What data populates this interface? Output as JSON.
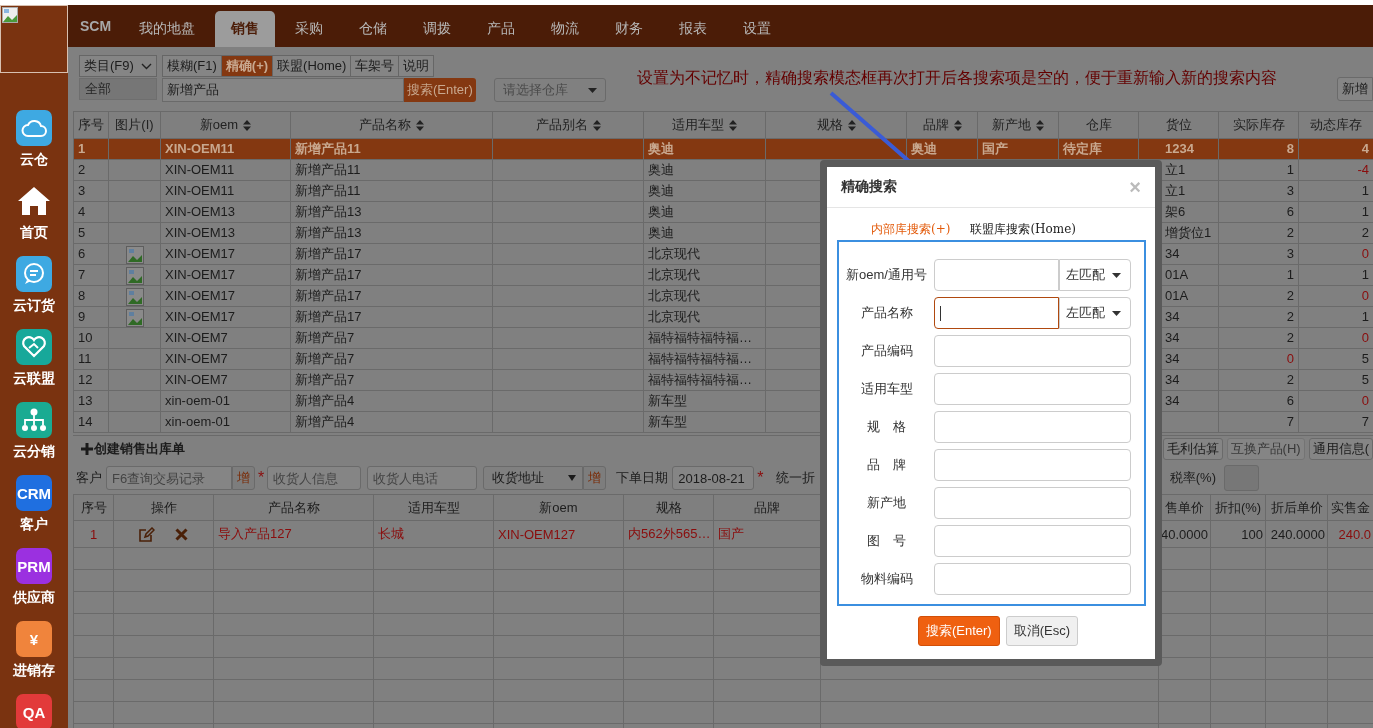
{
  "sidebar": {
    "items": [
      {
        "label": "云仓",
        "kind": "cloud",
        "color": "#3ea9e2"
      },
      {
        "label": "首页",
        "kind": "house"
      },
      {
        "label": "云订货",
        "kind": "chat",
        "color": "#3ea9e2"
      },
      {
        "label": "云联盟",
        "kind": "heart",
        "color": "#17a89a"
      },
      {
        "label": "云分销",
        "kind": "network",
        "color": "#1aab92"
      },
      {
        "label": "客户",
        "kind": "text",
        "badge": "CRM",
        "color": "#1f6fe0"
      },
      {
        "label": "供应商",
        "kind": "text",
        "badge": "PRM",
        "color": "#9b30e0"
      },
      {
        "label": "进销存",
        "kind": "text",
        "badge": "¥",
        "color": "#f0843c"
      },
      {
        "kind": "text",
        "badge": "QA",
        "color": "#e23a3a"
      }
    ]
  },
  "nav": {
    "brand": "SCM",
    "tabs": [
      {
        "label": "我的地盘",
        "selected": false
      },
      {
        "label": "销售",
        "selected": true
      },
      {
        "label": "采购",
        "selected": false
      },
      {
        "label": "仓储",
        "selected": false
      },
      {
        "label": "调拨",
        "selected": false
      },
      {
        "label": "产品",
        "selected": false
      },
      {
        "label": "物流",
        "selected": false
      },
      {
        "label": "财务",
        "selected": false
      },
      {
        "label": "报表",
        "selected": false
      },
      {
        "label": "设置",
        "selected": false
      }
    ]
  },
  "toolbar": {
    "category_select": "类目(F9)",
    "category_value": "全部",
    "modes": [
      {
        "label": "模糊(F1)",
        "selected": false
      },
      {
        "label": "精确(+)",
        "selected": true
      },
      {
        "label": "联盟(Home)",
        "selected": false
      },
      {
        "label": "车架号",
        "selected": false
      },
      {
        "label": "说明",
        "selected": false
      }
    ],
    "search": {
      "value": "新增产品"
    },
    "search_button": "搜索(Enter)",
    "warehouse_select": {
      "placeholder": "请选择仓库"
    },
    "new_button": "新增"
  },
  "annotation": "设置为不记忆时，精确搜索模态框再次打开后各搜索项是空的，便于重新输入新的搜索内容",
  "product_table": {
    "columns": [
      {
        "label": "序号",
        "sortable": false
      },
      {
        "label": "图片(I)",
        "sortable": false
      },
      {
        "label": "新oem",
        "sortable": true
      },
      {
        "label": "产品名称",
        "sortable": true
      },
      {
        "label": "产品别名",
        "sortable": true
      },
      {
        "label": "适用车型",
        "sortable": true
      },
      {
        "label": "规格",
        "sortable": true
      },
      {
        "label": "品牌",
        "sortable": true
      },
      {
        "label": "新产地",
        "sortable": true
      },
      {
        "label": "仓库",
        "sortable": false
      },
      {
        "label": "货位",
        "sortable": false
      },
      {
        "label": "实际库存",
        "sortable": false
      },
      {
        "label": "动态库存",
        "sortable": false
      }
    ],
    "rows": [
      {
        "no": "1",
        "image": false,
        "oem": "XIN-OEM11",
        "name": "新增产品11",
        "car": "奥迪",
        "brand": "奥迪",
        "origin": "国产",
        "warehouse": "待定库",
        "location": "1234",
        "actual": {
          "value": "8",
          "alert": false
        },
        "dynamic": {
          "value": "4",
          "alert": false
        },
        "selected": true
      },
      {
        "no": "2",
        "image": false,
        "oem": "XIN-OEM11",
        "name": "新增产品11",
        "car": "奥迪",
        "location": "立1",
        "actual": {
          "value": "1",
          "alert": false
        },
        "dynamic": {
          "value": "-4",
          "alert": true
        },
        "selected": false
      },
      {
        "no": "3",
        "image": false,
        "oem": "XIN-OEM11",
        "name": "新增产品11",
        "car": "奥迪",
        "location": "立1",
        "actual": {
          "value": "3",
          "alert": false
        },
        "dynamic": {
          "value": "1",
          "alert": false
        },
        "selected": false
      },
      {
        "no": "4",
        "image": false,
        "oem": "XIN-OEM13",
        "name": "新增产品13",
        "car": "奥迪",
        "location": "架6",
        "actual": {
          "value": "6",
          "alert": false
        },
        "dynamic": {
          "value": "1",
          "alert": false
        },
        "selected": false
      },
      {
        "no": "5",
        "image": false,
        "oem": "XIN-OEM13",
        "name": "新增产品13",
        "car": "奥迪",
        "location": "增货位1",
        "actual": {
          "value": "2",
          "alert": false
        },
        "dynamic": {
          "value": "2",
          "alert": false
        },
        "selected": false
      },
      {
        "no": "6",
        "image": true,
        "oem": "XIN-OEM17",
        "name": "新增产品17",
        "car": "北京现代",
        "location": "34",
        "actual": {
          "value": "3",
          "alert": false
        },
        "dynamic": {
          "value": "0",
          "alert": true
        },
        "selected": false
      },
      {
        "no": "7",
        "image": true,
        "oem": "XIN-OEM17",
        "name": "新增产品17",
        "car": "北京现代",
        "location": "01A",
        "actual": {
          "value": "1",
          "alert": false
        },
        "dynamic": {
          "value": "1",
          "alert": false
        },
        "selected": false
      },
      {
        "no": "8",
        "image": true,
        "oem": "XIN-OEM17",
        "name": "新增产品17",
        "car": "北京现代",
        "location": "01A",
        "actual": {
          "value": "2",
          "alert": false
        },
        "dynamic": {
          "value": "0",
          "alert": true
        },
        "selected": false
      },
      {
        "no": "9",
        "image": true,
        "oem": "XIN-OEM17",
        "name": "新增产品17",
        "car": "北京现代",
        "location": "34",
        "actual": {
          "value": "2",
          "alert": false
        },
        "dynamic": {
          "value": "1",
          "alert": false
        },
        "selected": false
      },
      {
        "no": "10",
        "image": false,
        "oem": "XIN-OEM7",
        "name": "新增产品7",
        "car": "福特福特福特福…",
        "location": "34",
        "actual": {
          "value": "2",
          "alert": false
        },
        "dynamic": {
          "value": "0",
          "alert": true
        },
        "selected": false
      },
      {
        "no": "11",
        "image": false,
        "oem": "XIN-OEM7",
        "name": "新增产品7",
        "car": "福特福特福特福…",
        "location": "34",
        "actual": {
          "value": "0",
          "alert": true
        },
        "dynamic": {
          "value": "5",
          "alert": false
        },
        "selected": false
      },
      {
        "no": "12",
        "image": false,
        "oem": "XIN-OEM7",
        "name": "新增产品7",
        "car": "福特福特福特福…",
        "location": "34",
        "actual": {
          "value": "2",
          "alert": false
        },
        "dynamic": {
          "value": "5",
          "alert": false
        },
        "selected": false
      },
      {
        "no": "13",
        "image": false,
        "oem": "xin-oem-01",
        "name": "新增产品4",
        "car": "新车型",
        "location": "34",
        "actual": {
          "value": "6",
          "alert": false
        },
        "dynamic": {
          "value": "0",
          "alert": true
        },
        "selected": false
      },
      {
        "no": "14",
        "image": false,
        "oem": "xin-oem-01",
        "name": "新增产品4",
        "car": "新车型",
        "actual": {
          "value": "7",
          "alert": false
        },
        "dynamic": {
          "value": "7",
          "alert": false
        },
        "selected": false
      }
    ]
  },
  "order": {
    "title": "创建销售出库单",
    "actions": [
      {
        "label": "毛利估算",
        "disabled": false
      },
      {
        "label": "互换产品(H)",
        "disabled": true
      },
      {
        "label": "通用信息(",
        "disabled": false
      }
    ],
    "form": {
      "customer_label": "客户",
      "customer": {
        "placeholder": "F6查询交易记录"
      },
      "customer_add": "增",
      "consignee_required": "*",
      "consignee": {
        "placeholder": "收货人信息"
      },
      "phone": {
        "placeholder": "收货人电话"
      },
      "address": {
        "placeholder": "收货地址"
      },
      "address_add": "增",
      "date_label": "下单日期",
      "date": {
        "value": "2018-08-21"
      },
      "date_required": "*",
      "discount_label": "统一折",
      "tax_label": "税率(%)"
    },
    "columns": [
      "序号",
      "操作",
      "产品名称",
      "适用车型",
      "新oem",
      "规格",
      "品牌",
      "售单价",
      "折扣(%)",
      "折后单价",
      "实售金"
    ],
    "rows": [
      {
        "no": "1",
        "name": "导入产品127",
        "car": "长城",
        "oem": "XIN-OEM127",
        "spec": "内562外565…",
        "brand": "国产",
        "price": "40.0000",
        "discount": "100",
        "net_price": "240.0000",
        "amount": "240.0"
      }
    ]
  },
  "dialog": {
    "title": "精确搜索",
    "close": "×",
    "tabs": [
      {
        "label": "内部库搜索(+)",
        "selected": true
      },
      {
        "label": "联盟库搜索(Home)",
        "selected": false
      }
    ],
    "fields": [
      {
        "label": "新oem/通用号",
        "match": "左匹配",
        "focused": false
      },
      {
        "label": "产品名称",
        "match": "左匹配",
        "focused": true
      },
      {
        "label": "产品编码",
        "focused": false
      },
      {
        "label": "适用车型",
        "focused": false
      },
      {
        "label": "规　格",
        "focused": false
      },
      {
        "label": "品　牌",
        "focused": false
      },
      {
        "label": "新产地",
        "focused": false
      },
      {
        "label": "图　号",
        "focused": false
      },
      {
        "label": "物料编码",
        "focused": false
      }
    ],
    "buttons": [
      {
        "label": "搜索(Enter)",
        "kind": "primary"
      },
      {
        "label": "取消(Esc)",
        "kind": "default"
      }
    ]
  }
}
